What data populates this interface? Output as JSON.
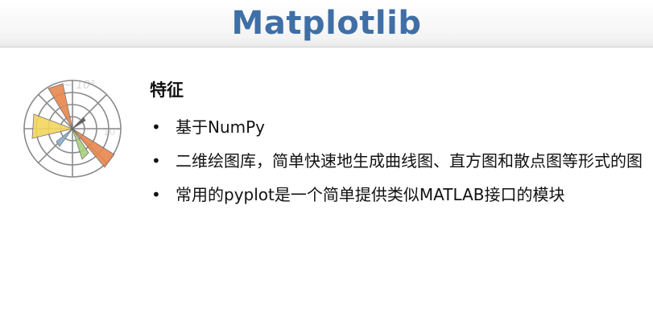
{
  "slide": {
    "title": "Matplotlib",
    "section_title": "特征",
    "bullets": [
      {
        "text": "基于NumPy"
      },
      {
        "text": "二维绘图库，简单快速地生成曲线图、直方图和散点图等形式的图"
      },
      {
        "text": "常用的pyplot是一个简单提供类似MATLAB接口的模块"
      }
    ]
  },
  "logo": {
    "name": "matplotlib-polar-logo",
    "colors": {
      "orange": "#e8874c",
      "yellow": "#f3d55e",
      "green": "#a7d37a",
      "blue": "#8ab4d8",
      "grid": "#8a8a8a"
    }
  }
}
